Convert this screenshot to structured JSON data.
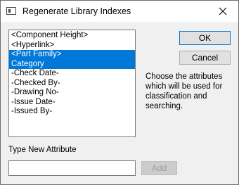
{
  "window": {
    "title": "Regenerate Library Indexes",
    "icon": "dialog-window-icon",
    "close_icon": "close-icon"
  },
  "attributes_list": {
    "items": [
      {
        "label": "<Component Height>",
        "selected": false
      },
      {
        "label": "<Hyperlink>",
        "selected": false
      },
      {
        "label": "<Part Family>",
        "selected": true
      },
      {
        "label": "Category",
        "selected": true
      },
      {
        "label": "-Check Date-",
        "selected": false
      },
      {
        "label": "-Checked By-",
        "selected": false
      },
      {
        "label": "-Drawing No-",
        "selected": false
      },
      {
        "label": "-Issue Date-",
        "selected": false
      },
      {
        "label": "-Issued By-",
        "selected": false
      }
    ]
  },
  "buttons": {
    "ok": "OK",
    "cancel": "Cancel",
    "add": "Add"
  },
  "help_text": "Choose the attributes which will be used for classification and searching.",
  "new_attribute": {
    "label": "Type New Attribute",
    "value": ""
  },
  "colors": {
    "selection": "#0078d7",
    "dialog_background": "#f0f0f0"
  }
}
